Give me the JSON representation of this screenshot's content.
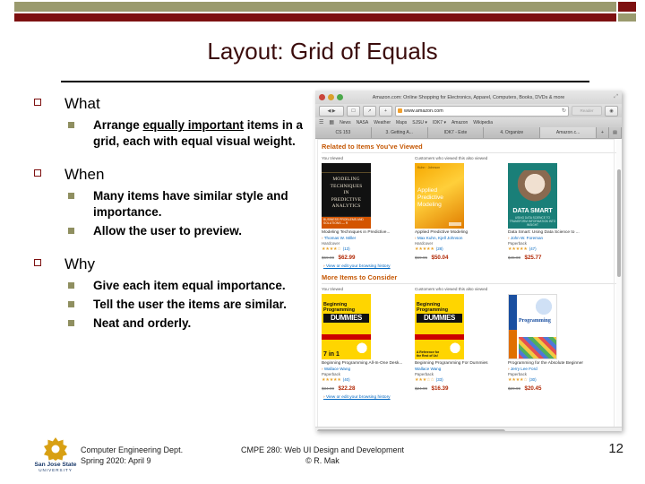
{
  "slide": {
    "title": "Layout: Grid of Equals",
    "page_number": "12",
    "accent_olive": "#9a9a6e",
    "accent_red": "#7d1010",
    "title_color": "#3b0c0c"
  },
  "content": {
    "groups": [
      {
        "heading": "What",
        "bullets": [
          {
            "pre": "Arrange ",
            "underlined": "equally important",
            "post": " items in a grid, each with equal visual weight."
          }
        ]
      },
      {
        "heading": "When",
        "bullets": [
          {
            "pre": "Many items have similar style and importance.",
            "underlined": "",
            "post": ""
          },
          {
            "pre": "Allow the user to preview.",
            "underlined": "",
            "post": ""
          }
        ]
      },
      {
        "heading": "Why",
        "bullets": [
          {
            "pre": "Give each item equal importance.",
            "underlined": "",
            "post": ""
          },
          {
            "pre": "Tell the user the items are similar.",
            "underlined": "",
            "post": ""
          },
          {
            "pre": "Neat and orderly.",
            "underlined": "",
            "post": ""
          }
        ]
      }
    ]
  },
  "screenshot": {
    "window_title": "Amazon.com: Online Shopping for Electronics, Apparel, Computers, Books, DVDs & more",
    "url": "www.amazon.com",
    "reader_label": "Reader",
    "bookmarks": [
      "News",
      "NASA",
      "Weather",
      "Maps",
      "SJSU ▾",
      "IDK7 ▾",
      "Amazon",
      "Wikipedia"
    ],
    "tabs": [
      "CS 153",
      "3. Getting A...",
      "IDK7 - Exte",
      "4. Organize",
      "Amazon.c..."
    ],
    "sections": [
      {
        "heading": "Related to Items You've Viewed",
        "col_headers": [
          "You Viewed",
          "Customers who viewed this also viewed"
        ],
        "books": [
          {
            "title": "Modeling Techniques in Predictive...",
            "author": "Thomas W. Miller",
            "binding": "Hardcover",
            "stars": "★★★★☆",
            "count": "(13)",
            "old_price": "$69.99",
            "price": "$62.99",
            "cover_lines": [
              "MODELING",
              "TECHNIQUES",
              "IN",
              "PREDICTIVE",
              "ANALYTICS"
            ],
            "cover_footer": "BUSINESS PROBLEMS AND SOLUTIONS — R"
          },
          {
            "title": "Applied Predictive Modeling",
            "author": "Max Kuhn, Kjell Johnson",
            "binding": "Hardcover",
            "stars": "★★★★★",
            "count": "(28)",
            "old_price": "$69.95",
            "price": "$50.04",
            "cover_lines": [
              "Applied",
              "Predictive",
              "Modeling"
            ],
            "cover_footer": "Kuhn · Johnson"
          },
          {
            "title": "Data Smart: Using Data Science to ...",
            "author": "John W. Foreman",
            "binding": "Paperback",
            "stars": "★★★★★",
            "count": "(47)",
            "old_price": "$45.00",
            "price": "$25.77",
            "cover_lines": [
              "DATA SMART"
            ],
            "cover_footer": "USING DATA SCIENCE TO TRANSFORM INFORMATION INTO INSIGHT"
          }
        ],
        "history_link": "View or edit your browsing history"
      },
      {
        "heading": "More Items to Consider",
        "col_headers": [
          "You Viewed",
          "Customers who viewed this also viewed"
        ],
        "books": [
          {
            "title": "Beginning Programming All-In-One Desk...",
            "author": "Wallace Wang",
            "binding": "Paperback",
            "stars": "★★★★★",
            "count": "(40)",
            "old_price": "$34.99",
            "price": "$22.28",
            "cover_lines": [
              "Beginning",
              "Programming",
              "DUMMIES"
            ],
            "cover_footer": "7 in 1"
          },
          {
            "title": "Beginning Programming For Dummies",
            "author": "Wallace Wang",
            "binding": "Paperback",
            "stars": "★★★☆☆",
            "count": "(33)",
            "old_price": "$24.99",
            "price": "$16.39",
            "cover_lines": [
              "Beginning",
              "Programming",
              "DUMMIES"
            ],
            "cover_footer": "A Reference for the Rest of Us!"
          },
          {
            "title": "Programming for the Absolute Beginner",
            "author": "Jerry Lee Ford",
            "binding": "Paperback",
            "stars": "★★★★☆",
            "count": "(30)",
            "old_price": "$29.99",
            "price": "$20.45",
            "cover_lines": [
              "Programming"
            ],
            "cover_footer": "for the Absolute Beginner"
          }
        ],
        "history_link": "View or edit your browsing history"
      }
    ]
  },
  "footer": {
    "dept": "Computer Engineering Dept.",
    "term": "Spring 2020: April 9",
    "course": "CMPE 280: Web UI Design and Development",
    "copyright": "© R. Mak",
    "logo_line1": "San Jose State",
    "logo_line2": "UNIVERSITY"
  }
}
